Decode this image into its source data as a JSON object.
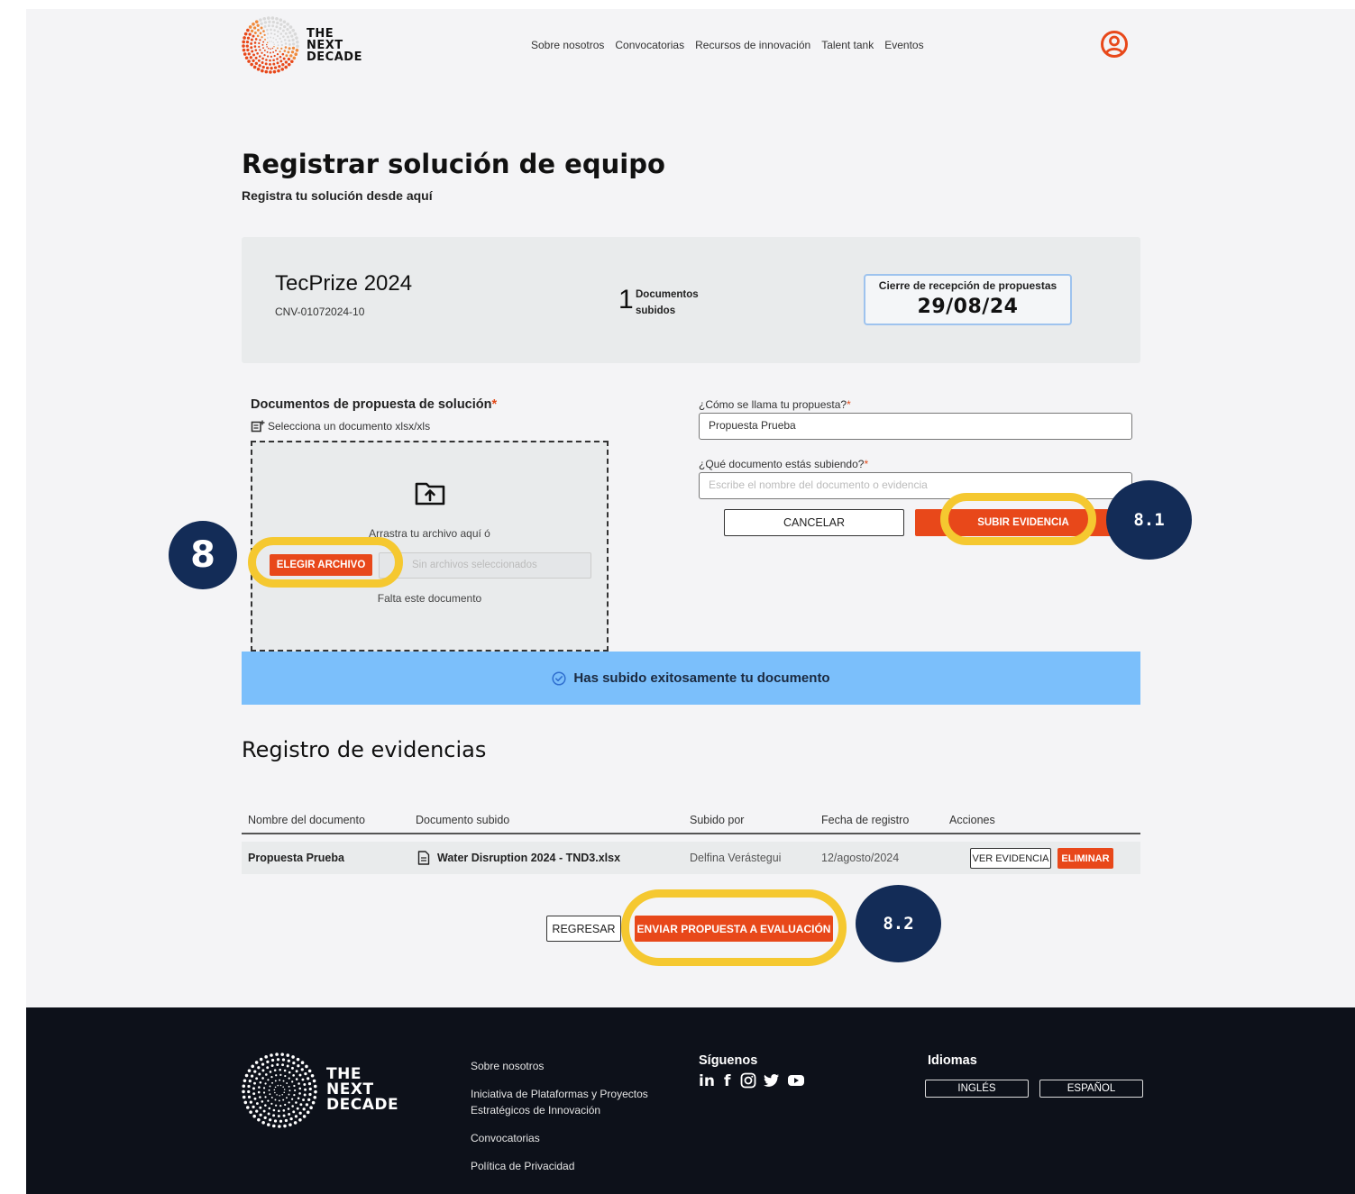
{
  "header": {
    "logo_lines": [
      "THE",
      "NEXT",
      "DECADE"
    ],
    "nav": [
      "Sobre nosotros",
      "Convocatorias",
      "Recursos de innovación",
      "Talent tank",
      "Eventos"
    ]
  },
  "page": {
    "title": "Registrar solución de equipo",
    "subtitle": "Registra tu solución desde aquí"
  },
  "summary": {
    "name": "TecPrize 2024",
    "code": "CNV-01072024-10",
    "doc_count": "1",
    "doc_label_1": "Documentos",
    "doc_label_2": "subidos",
    "deadline_label": "Cierre de recepción de propuestas",
    "deadline_date": "29/08/24"
  },
  "upload": {
    "title": "Documentos de propuesta de solución",
    "required_mark": "*",
    "hint": "Selecciona un documento xlsx/xls",
    "drag_text": "Arrastra tu archivo aquí ó",
    "choose_label": "ELEGIR ARCHIVO",
    "file_status": "Sin archivos seleccionados",
    "missing_text": "Falta este documento"
  },
  "form": {
    "name_label": "¿Cómo se llama tu propuesta?",
    "name_value": "Propuesta Prueba",
    "doc_label": "¿Qué documento estás subiendo?",
    "doc_placeholder": "Escribe el nombre del documento o evidencia",
    "required_mark": "*",
    "cancel_label": "CANCELAR",
    "submit_label": "SUBIR EVIDENCIA"
  },
  "banner": {
    "text": "Has subido exitosamente tu documento"
  },
  "evidence": {
    "title": "Registro de evidencias",
    "columns": [
      "Nombre del documento",
      "Documento subido",
      "Subido por",
      "Fecha de registro",
      "Acciones"
    ],
    "rows": [
      {
        "name": "Propuesta Prueba",
        "file": "Water Disruption 2024 - TND3.xlsx",
        "uploaded_by": "Delfina Verástegui",
        "date": "12/agosto/2024",
        "view_label": "VER EVIDENCIA",
        "delete_label": "ELIMINAR"
      }
    ]
  },
  "actions": {
    "back_label": "REGRESAR",
    "send_label": "ENVIAR PROPUESTA A EVALUACIÓN"
  },
  "callouts": {
    "step_1": "8",
    "step_2": "8.1",
    "step_3": "8.2"
  },
  "footer": {
    "logo_lines": [
      "THE",
      "NEXT",
      "DECADE"
    ],
    "links": [
      "Sobre nosotros",
      "Iniciativa de Plataformas y Proyectos",
      "Estratégicos de Innovación",
      "Convocatorias",
      "Política de Privacidad"
    ],
    "follow_title": "Síguenos",
    "social_icons": [
      "linkedin-icon",
      "facebook-icon",
      "instagram-icon",
      "twitter-icon",
      "youtube-icon"
    ],
    "languages_title": "Idiomas",
    "lang_en": "INGLÉS",
    "lang_es": "ESPAÑOL"
  },
  "colors": {
    "accent": "#e8481a",
    "banner": "#7bbffb",
    "highlight": "#f5c830",
    "badge": "#132c57",
    "footer": "#0d111a"
  }
}
